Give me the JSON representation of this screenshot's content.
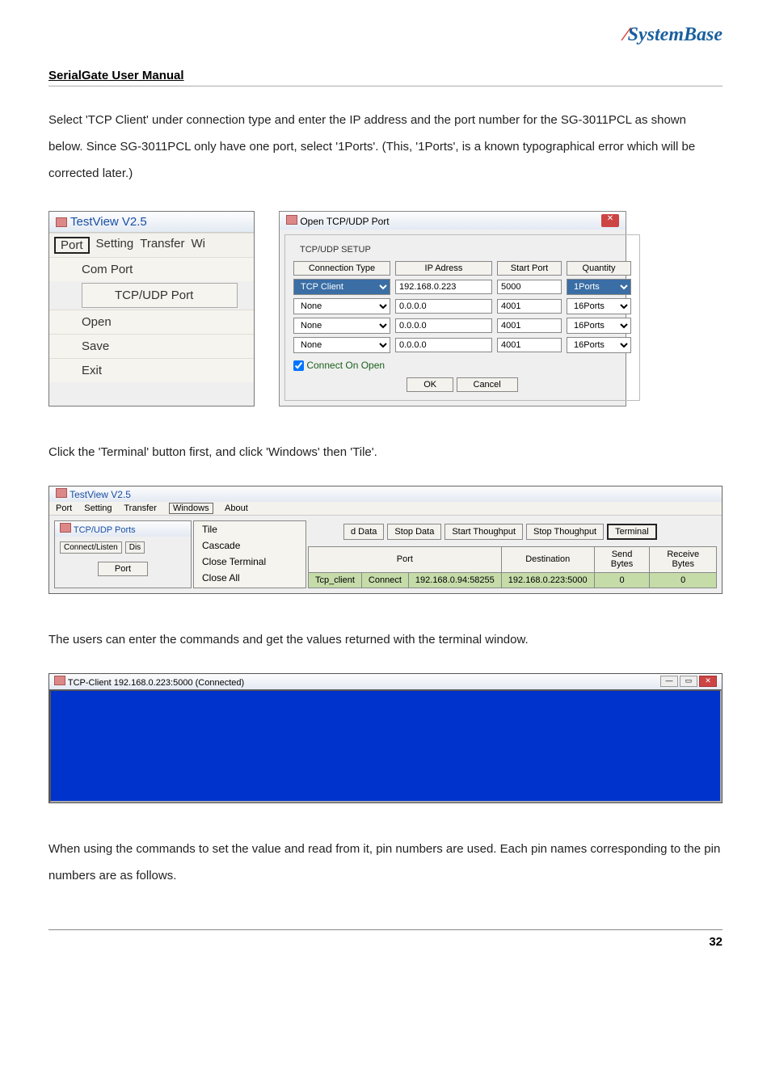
{
  "logo": {
    "text": "SystemBase"
  },
  "header": "SerialGate User Manual",
  "para1": "Select 'TCP Client' under connection type and enter the IP address and the port number for the SG-3011PCL as shown below. Since SG-3011PCL only have one port, select '1Ports'. (This, '1Ports', is a known typographical error which will be corrected later.)",
  "menu": {
    "title": "TestView V2.5",
    "top": {
      "port": "Port",
      "setting": "Setting",
      "transfer": "Transfer",
      "wi": "Wi"
    },
    "items": [
      "Com Port",
      "TCP/UDP Port",
      "Open",
      "Save",
      "Exit"
    ]
  },
  "dialog": {
    "title": "Open TCP/UDP Port",
    "group": "TCP/UDP SETUP",
    "headers": {
      "conn": "Connection Type",
      "ip": "IP Adress",
      "start": "Start Port",
      "qty": "Quantity"
    },
    "rows": [
      {
        "conn": "TCP Client",
        "ip": "192.168.0.223",
        "start": "5000",
        "qty": "1Ports",
        "hl": true
      },
      {
        "conn": "None",
        "ip": "0.0.0.0",
        "start": "4001",
        "qty": "16Ports",
        "hl": false
      },
      {
        "conn": "None",
        "ip": "0.0.0.0",
        "start": "4001",
        "qty": "16Ports",
        "hl": false
      },
      {
        "conn": "None",
        "ip": "0.0.0.0",
        "start": "4001",
        "qty": "16Ports",
        "hl": false
      }
    ],
    "connect_on_open": "Connect On Open",
    "ok": "OK",
    "cancel": "Cancel"
  },
  "para2": "Click the 'Terminal' button first, and click 'Windows' then 'Tile'.",
  "shot2": {
    "title": "TestView V2.5",
    "menubar": [
      "Port",
      "Setting",
      "Transfer",
      "Windows",
      "About"
    ],
    "ports_title": "TCP/UDP Ports",
    "connect": "Connect/Listen",
    "dis": "Dis",
    "port_btn": "Port",
    "sub_menu": [
      "Tile",
      "Cascade",
      "Close Terminal",
      "Close All"
    ],
    "strip": {
      "d": "d Data",
      "stop": "Stop Data",
      "start": "Start Thoughput",
      "stopt": "Stop Thoughput",
      "term": "Terminal"
    },
    "thead": {
      "port": "Port",
      "dest": "Destination",
      "send": "Send\nBytes",
      "recv": "Receive\nBytes"
    },
    "row": {
      "name": "Tcp_client",
      "status": "Connect",
      "local": "192.168.0.94:58255",
      "dest": "192.168.0.223:5000",
      "send": "0",
      "recv": "0"
    }
  },
  "para3": "The users can enter the commands and get the values returned with the terminal window.",
  "term_title": "TCP-Client 192.168.0.223:5000 (Connected)",
  "para4": "When using the commands to set the value and read from it, pin numbers are used. Each pin names corresponding to the pin numbers are as follows.",
  "page_num": "32"
}
